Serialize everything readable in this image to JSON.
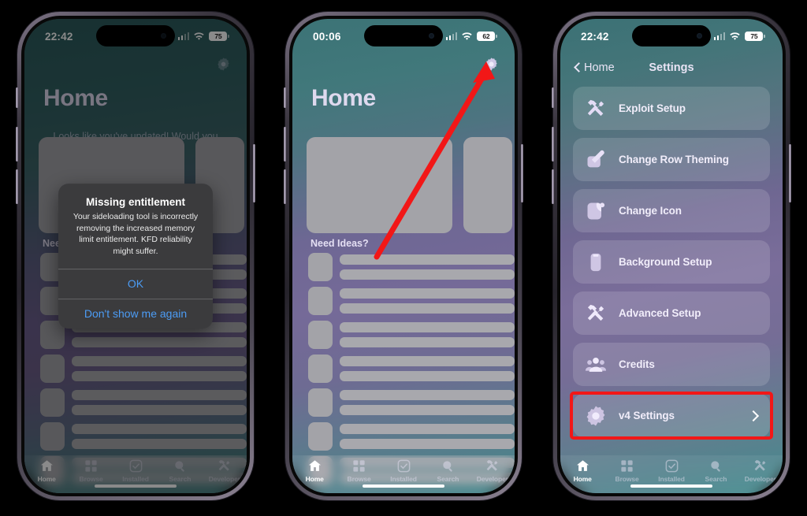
{
  "background_color": "#000000",
  "accent_colors": {
    "annotation_red": "#f21717",
    "alert_button_blue": "#4c9cf5",
    "app_gradient_teal": "#3b7175",
    "app_gradient_purple": "#756a98"
  },
  "tab_bar": {
    "items": [
      {
        "label": "Home",
        "icon": "house-icon",
        "active": true
      },
      {
        "label": "Browse",
        "icon": "grid-squares-icon",
        "active": false
      },
      {
        "label": "Installed",
        "icon": "checkmark-square-icon",
        "active": false
      },
      {
        "label": "Search",
        "icon": "magnifier-icon",
        "active": false
      },
      {
        "label": "Developer",
        "icon": "wrench-screwdriver-icon",
        "active": false
      }
    ]
  },
  "phone1": {
    "status_bar": {
      "time": "22:42",
      "cellular": "signal-bars-icon",
      "wifi": "wifi-icon",
      "battery_level": "75"
    },
    "title": "Home",
    "update_note": "Looks like you've updated! Would you like to rerun Setup?",
    "section_header": "Need Ideas?",
    "gear_icon": "gear-icon",
    "alert": {
      "title": "Missing entitlement",
      "message": "Your sideloading tool is incorrectly removing the increased memory limit entitlement. KFD reliability might suffer.",
      "primary_button": "OK",
      "secondary_button": "Don't show me again"
    }
  },
  "phone2": {
    "status_bar": {
      "time": "00:06",
      "cellular": "signal-bars-icon",
      "wifi": "wifi-icon",
      "battery_level": "62"
    },
    "title": "Home",
    "section_header": "Need Ideas?",
    "gear_icon": "gear-icon",
    "annotation": {
      "type": "arrow",
      "color": "#f21717",
      "points_to": "gear-icon"
    }
  },
  "phone3": {
    "status_bar": {
      "time": "22:42",
      "cellular": "signal-bars-icon",
      "wifi": "wifi-icon",
      "battery_level": "75"
    },
    "nav": {
      "back_label": "Home",
      "back_icon": "chevron-left-icon",
      "title": "Settings"
    },
    "rows": [
      {
        "label": "Exploit Setup",
        "icon": "wrench-screwdriver-icon",
        "chevron": false,
        "highlighted": false
      },
      {
        "label": "Change Row Theming",
        "icon": "pencil-square-icon",
        "chevron": false,
        "highlighted": false
      },
      {
        "label": "Change Icon",
        "icon": "app-icon",
        "chevron": false,
        "highlighted": false
      },
      {
        "label": "Background Setup",
        "icon": "phone-case-icon",
        "chevron": false,
        "highlighted": false
      },
      {
        "label": "Advanced Setup",
        "icon": "wrench-screwdriver-icon",
        "chevron": false,
        "highlighted": false
      },
      {
        "label": "Credits",
        "icon": "people-group-icon",
        "chevron": false,
        "highlighted": false
      },
      {
        "label": "v4 Settings",
        "icon": "gear-icon",
        "chevron": true,
        "highlighted": true
      }
    ]
  }
}
